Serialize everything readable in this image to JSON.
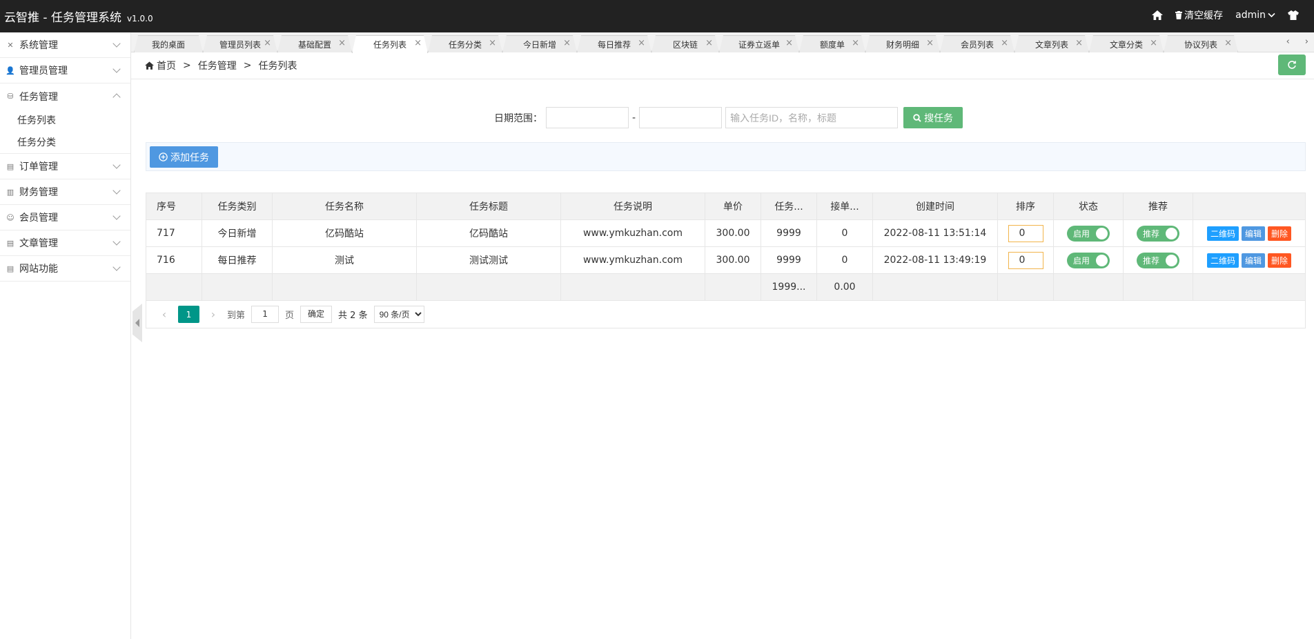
{
  "app": {
    "title": "云智推 - 任务管理系统",
    "version": "v1.0.0"
  },
  "topbar": {
    "home_icon": "home-icon",
    "clear_cache": "清空缓存",
    "user": "admin",
    "shirt_icon": "shirt-icon"
  },
  "sidebar": {
    "items": [
      {
        "label": "系统管理",
        "icon": "tools-icon",
        "expanded": false
      },
      {
        "label": "管理员管理",
        "icon": "user-icon",
        "expanded": false
      },
      {
        "label": "任务管理",
        "icon": "database-icon",
        "expanded": true,
        "children": [
          "任务列表",
          "任务分类"
        ]
      },
      {
        "label": "订单管理",
        "icon": "table-icon",
        "expanded": false
      },
      {
        "label": "财务管理",
        "icon": "book-icon",
        "expanded": false
      },
      {
        "label": "会员管理",
        "icon": "members-icon",
        "expanded": false
      },
      {
        "label": "文章管理",
        "icon": "list-icon",
        "expanded": false
      },
      {
        "label": "网站功能",
        "icon": "list-icon",
        "expanded": false
      }
    ]
  },
  "tabs": [
    "我的桌面",
    "管理员列表",
    "基础配置",
    "任务列表",
    "任务分类",
    "今日新增",
    "每日推荐",
    "区块链",
    "证券立返单",
    "额度单",
    "财务明细",
    "会员列表",
    "文章列表",
    "文章分类",
    "协议列表"
  ],
  "active_tab": 3,
  "breadcrumb": {
    "home": "首页",
    "level1": "任务管理",
    "level2": "任务列表",
    "separator": ">"
  },
  "filter": {
    "label": "日期范围：",
    "date_start": "",
    "date_end": "",
    "dash": "-",
    "keyword_placeholder": "输入任务ID，名称，标题",
    "search_button": "搜任务"
  },
  "toolbar": {
    "add_button": "添加任务"
  },
  "table": {
    "headers": [
      "序号",
      "任务类别",
      "任务名称",
      "任务标题",
      "任务说明",
      "单价",
      "任务...",
      "接单...",
      "创建时间",
      "排序",
      "状态",
      "推荐",
      ""
    ],
    "rows": [
      {
        "id": "717",
        "category": "今日新增",
        "name": "亿码酷站",
        "title": "亿码酷站",
        "desc": "www.ymkuzhan.com",
        "price": "300.00",
        "qty": "9999",
        "taken": "0",
        "created": "2022-08-11 13:51:14",
        "sort": "0",
        "status": "启用",
        "recommend": "推荐"
      },
      {
        "id": "716",
        "category": "每日推荐",
        "name": "测试",
        "title": "测试测试",
        "desc": "www.ymkuzhan.com",
        "price": "300.00",
        "qty": "9999",
        "taken": "0",
        "created": "2022-08-11 13:49:19",
        "sort": "0",
        "status": "启用",
        "recommend": "推荐"
      }
    ],
    "totals": {
      "qty": "1999...",
      "taken": "0.00"
    },
    "actions": {
      "qr": "二维码",
      "edit": "编辑",
      "delete": "删除"
    }
  },
  "pagination": {
    "current": "1",
    "goto_label": "到第",
    "page_input": "1",
    "page_unit": "页",
    "confirm": "确定",
    "total": "共 2 条",
    "per_page": "90 条/页"
  },
  "colors": {
    "topbar": "#222222",
    "green": "#5fb878",
    "blue": "#4f98e1",
    "teal": "#009688",
    "danger": "#ff5722",
    "qr": "#1e9fff"
  }
}
